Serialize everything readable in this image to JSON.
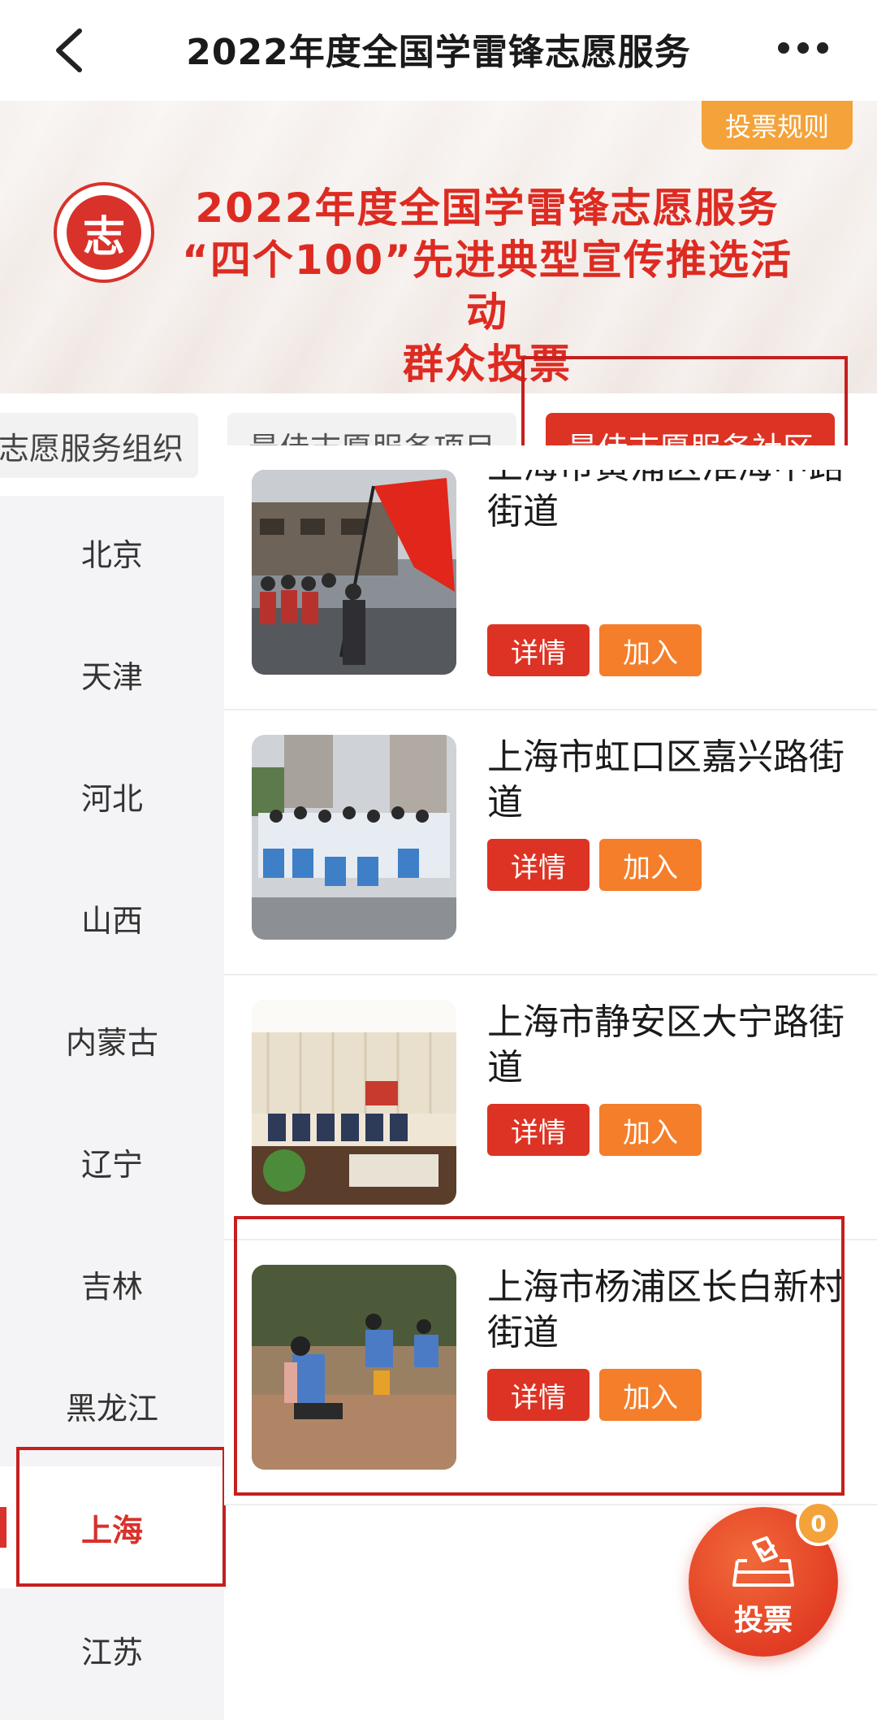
{
  "nav": {
    "title": "2022年度全国学雷锋志愿服务"
  },
  "banner": {
    "rules_label": "投票规则",
    "logo_char": "志",
    "lines": [
      "2022年度全国学雷锋志愿服务",
      "“四个100”先进典型宣传推选活动",
      "群众投票"
    ]
  },
  "tabs": [
    {
      "label": "最佳志愿服务组织",
      "shown": "志愿服务组织",
      "active": false
    },
    {
      "label": "最佳志愿服务项目",
      "active": false
    },
    {
      "label": "最佳志愿服务社区",
      "active": true
    }
  ],
  "sidebar": {
    "items": [
      "北京",
      "天津",
      "河北",
      "山西",
      "内蒙古",
      "辽宁",
      "吉林",
      "黑龙江",
      "上海",
      "江苏"
    ],
    "active": "上海"
  },
  "list": {
    "detail_label": "详情",
    "join_label": "加入",
    "cards": [
      {
        "title": "上海市黄浦区淮海中路街道",
        "title_visible": "中路街道"
      },
      {
        "title": "上海市虹口区嘉兴路街道"
      },
      {
        "title": "上海市静安区大宁路街道"
      },
      {
        "title": "上海市杨浦区长白新村街道"
      }
    ]
  },
  "vote": {
    "label": "投票",
    "count": "0"
  },
  "colors": {
    "accent": "#dd3324",
    "orange": "#f47e2a",
    "rules": "#f4a23a"
  }
}
